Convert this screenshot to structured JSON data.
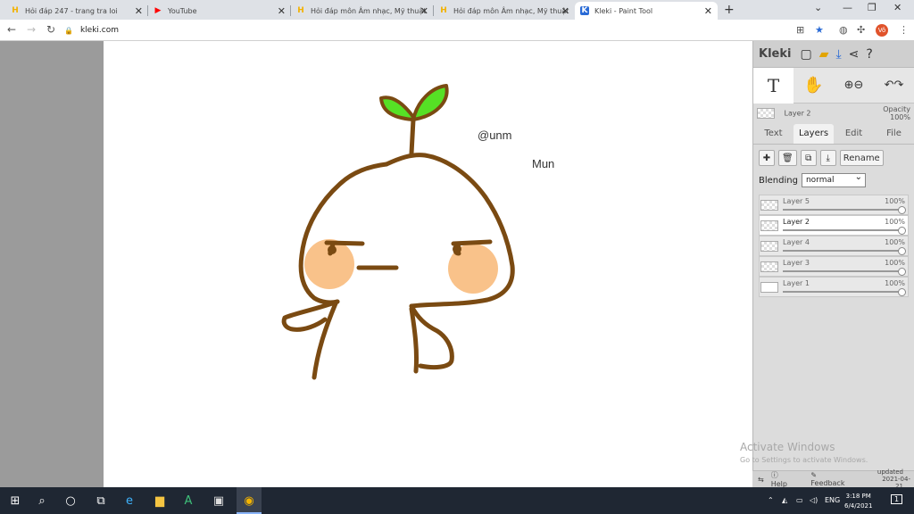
{
  "browser": {
    "tabs": [
      {
        "title": "Hỏi đáp 247 - trang tra loi",
        "favicon": "H",
        "favicon_color": "#f2b100"
      },
      {
        "title": "YouTube",
        "favicon": "▶",
        "favicon_color": "#ff0000"
      },
      {
        "title": "Hỏi đáp môn Âm nhạc, Mỹ thuật",
        "favicon": "H",
        "favicon_color": "#f2b100"
      },
      {
        "title": "Hỏi đáp môn Âm nhạc, Mỹ thuật",
        "favicon": "H",
        "favicon_color": "#f2b100"
      },
      {
        "title": "Kleki - Paint Tool",
        "favicon": "K",
        "favicon_color": "#2a6bd6",
        "active": true
      }
    ],
    "url": "kleki.com",
    "profile_initials": "Vô"
  },
  "canvas": {
    "texts": [
      "@unm",
      "Mun"
    ],
    "colors": {
      "outline": "#7a4a12",
      "leaf": "#56e025",
      "cheek": "#f9c28a"
    }
  },
  "kleki": {
    "logo": "Kleki",
    "current_layer": "Layer 2",
    "opacity_label": "Opacity",
    "opacity_value": "100%",
    "tabs": [
      "Text",
      "Layers",
      "Edit",
      "File"
    ],
    "rename_label": "Rename",
    "blending_label": "Blending",
    "blending_value": "normal",
    "layers": [
      {
        "name": "Layer 5",
        "opacity": "100%"
      },
      {
        "name": "Layer 2",
        "opacity": "100%",
        "selected": true
      },
      {
        "name": "Layer 4",
        "opacity": "100%"
      },
      {
        "name": "Layer 3",
        "opacity": "100%"
      },
      {
        "name": "Layer 1",
        "opacity": "100%"
      }
    ],
    "footer": {
      "help": "Help",
      "feedback": "Feedback",
      "updated_label": "updated",
      "updated_date": "2021-04-21"
    }
  },
  "watermark": {
    "line1": "Activate Windows",
    "line2": "Go to Settings to activate Windows."
  },
  "taskbar": {
    "language": "ENG",
    "time": "3:18 PM",
    "date": "6/4/2021",
    "notifications": "1"
  }
}
